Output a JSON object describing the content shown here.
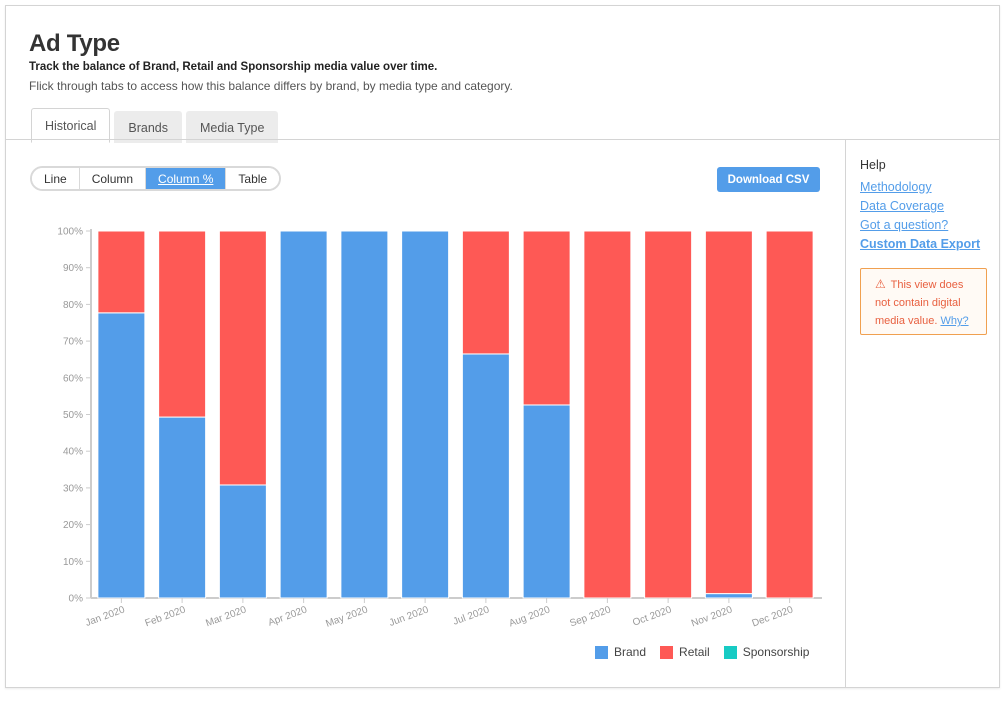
{
  "header": {
    "title": "Ad Type",
    "subtitle": "Track the balance of Brand, Retail and Sponsorship media value over time.",
    "description": "Flick through tabs to access how this balance differs by brand, by media type and category."
  },
  "tabs": [
    {
      "label": "Historical",
      "active": true
    },
    {
      "label": "Brands",
      "active": false
    },
    {
      "label": "Media Type",
      "active": false
    }
  ],
  "view_toggle": [
    {
      "label": "Line",
      "active": false
    },
    {
      "label": "Column",
      "active": false
    },
    {
      "label": "Column %",
      "active": true
    },
    {
      "label": "Table",
      "active": false
    }
  ],
  "download_button": "Download CSV",
  "help": {
    "title": "Help",
    "links": [
      "Methodology",
      "Data Coverage",
      "Got a question?",
      "Custom Data Export"
    ]
  },
  "warning": {
    "icon": "warning-triangle-icon",
    "text": "This view does not contain digital media value.",
    "link": "Why?"
  },
  "colors": {
    "accent": "#539de9",
    "brand": "#539de9",
    "retail": "#fe5955",
    "sponsorship": "#17cbc4",
    "warning": "#e86040"
  },
  "chart_data": {
    "type": "bar",
    "stacked": true,
    "normalized": true,
    "title": "",
    "xlabel": "",
    "ylabel": "",
    "ylim": [
      0,
      100
    ],
    "y_ticks": [
      "0%",
      "10%",
      "20%",
      "30%",
      "40%",
      "50%",
      "60%",
      "70%",
      "80%",
      "90%",
      "100%"
    ],
    "categories": [
      "Jan 2020",
      "Feb 2020",
      "Mar 2020",
      "Apr 2020",
      "May 2020",
      "Jun 2020",
      "Jul 2020",
      "Aug 2020",
      "Sep 2020",
      "Oct 2020",
      "Nov 2020",
      "Dec 2020"
    ],
    "series": [
      {
        "name": "Brand",
        "color": "#539de9",
        "values": [
          77.7,
          49.3,
          30.8,
          100,
          100,
          100,
          66.5,
          52.6,
          0,
          0,
          1.2,
          0
        ]
      },
      {
        "name": "Retail",
        "color": "#fe5955",
        "values": [
          22.3,
          50.7,
          69.2,
          0,
          0,
          0,
          33.5,
          47.4,
          100,
          100,
          98.8,
          100
        ]
      },
      {
        "name": "Sponsorship",
        "color": "#17cbc4",
        "values": [
          0,
          0,
          0,
          0,
          0,
          0,
          0,
          0,
          0,
          0,
          0,
          0
        ]
      }
    ],
    "legend": "bottom-right",
    "grid": false
  }
}
